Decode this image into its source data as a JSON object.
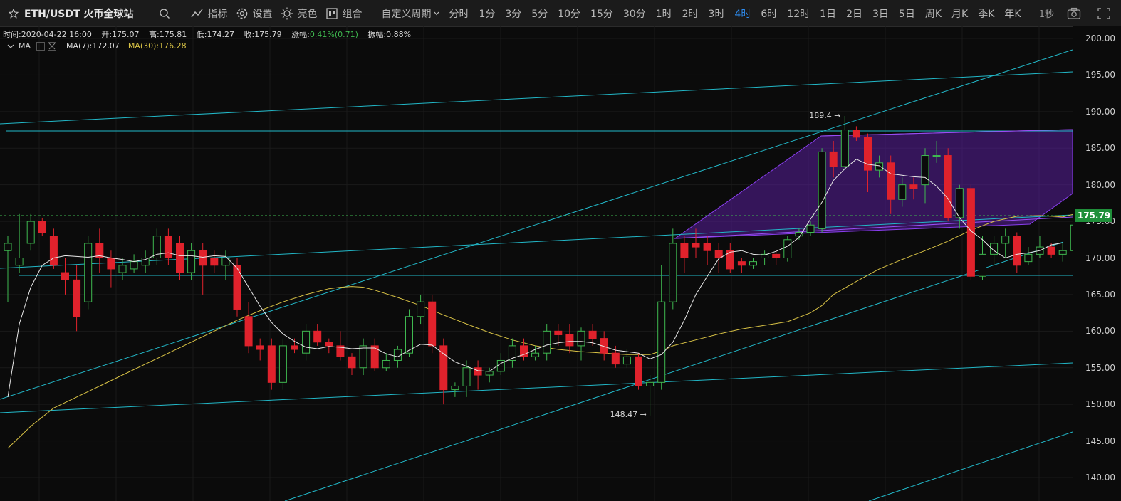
{
  "toolbar": {
    "title": "ETH/USDT 火币全球站",
    "buttons": {
      "indicators": "指标",
      "settings": "设置",
      "theme": "亮色",
      "combo": "组合"
    },
    "custom_period": "自定义周期",
    "periods": [
      "分时",
      "1分",
      "3分",
      "5分",
      "10分",
      "15分",
      "30分",
      "1时",
      "2时",
      "3时",
      "4时",
      "6时",
      "12时",
      "1日",
      "2日",
      "3日",
      "5日",
      "周K",
      "月K",
      "季K",
      "年K"
    ],
    "active_period": "4时",
    "refresh": "1秒"
  },
  "info": {
    "time": "时间:2020-04-22 16:00",
    "open": "开:175.07",
    "high": "高:175.81",
    "low": "低:174.27",
    "close": "收:175.79",
    "change_label": "涨幅:",
    "change_value": "0.41%(0.71)",
    "amplitude": "振幅:0.88%"
  },
  "ma": {
    "name": "MA",
    "ma7": "MA(7):172.07",
    "ma30": "MA(30):176.28"
  },
  "colors": {
    "up": "#3fb950",
    "down": "#e0222c",
    "ma7": "#e8e8e8",
    "ma30": "#d8c245",
    "trendline": "#22b8c8",
    "channel": "#7a2fd0",
    "current_price_bg": "#1f8f3a",
    "active_period": "#2d8cf0"
  },
  "chart_data": {
    "type": "candlestick",
    "y_ticks": [
      "200.00",
      "195.00",
      "190.00",
      "185.00",
      "180.00",
      "175.00",
      "170.00",
      "165.00",
      "160.00",
      "155.00",
      "150.00",
      "145.00",
      "140.00"
    ],
    "ylim": [
      137.5,
      202
    ],
    "current_price": "175.79",
    "annotations": {
      "high": "189.4 →",
      "low": "148.47 →"
    },
    "candles": [
      [
        171.0,
        172.0,
        164.0,
        173.0
      ],
      [
        169.0,
        170.0,
        168.0,
        176.0
      ],
      [
        172.0,
        175.0,
        171.0,
        176.0
      ],
      [
        175.0,
        173.5,
        173.0,
        175.5
      ],
      [
        173.0,
        169.0,
        168.5,
        174.0
      ],
      [
        168.0,
        167.0,
        165.0,
        170.0
      ],
      [
        167.0,
        162.0,
        160.0,
        169.0
      ],
      [
        164.0,
        172.0,
        163.0,
        173.0
      ],
      [
        172.0,
        170.0,
        168.0,
        174.0
      ],
      [
        170.0,
        168.5,
        166.0,
        171.0
      ],
      [
        168.0,
        169.0,
        167.0,
        170.0
      ],
      [
        168.5,
        169.5,
        168.0,
        170.5
      ],
      [
        169.0,
        170.0,
        168.0,
        171.0
      ],
      [
        170.0,
        173.0,
        169.0,
        174.0
      ],
      [
        173.0,
        170.0,
        169.0,
        174.0
      ],
      [
        172.0,
        168.0,
        167.0,
        173.0
      ],
      [
        168.0,
        171.0,
        167.0,
        172.0
      ],
      [
        171.0,
        169.0,
        165.0,
        172.0
      ],
      [
        170.0,
        169.0,
        168.0,
        171.0
      ],
      [
        169.0,
        170.0,
        167.0,
        171.0
      ],
      [
        169.0,
        163.0,
        162.0,
        170.0
      ],
      [
        162.0,
        158.0,
        157.0,
        164.0
      ],
      [
        158.0,
        157.5,
        156.0,
        159.0
      ],
      [
        158.0,
        153.0,
        152.0,
        159.0
      ],
      [
        153.0,
        158.0,
        152.0,
        159.0
      ],
      [
        158.0,
        157.5,
        157.0,
        159.0
      ],
      [
        157.0,
        160.0,
        156.0,
        161.0
      ],
      [
        160.0,
        158.5,
        158.0,
        161.0
      ],
      [
        158.5,
        158.0,
        157.0,
        159.0
      ],
      [
        158.0,
        156.5,
        156.0,
        160.0
      ],
      [
        156.5,
        155.0,
        154.0,
        157.0
      ],
      [
        155.0,
        158.0,
        154.0,
        159.0
      ],
      [
        158.0,
        155.0,
        154.5,
        159.0
      ],
      [
        155.0,
        156.0,
        154.5,
        157.0
      ],
      [
        156.0,
        157.5,
        155.0,
        158.0
      ],
      [
        157.0,
        162.0,
        156.5,
        163.0
      ],
      [
        162.0,
        164.0,
        161.0,
        165.0
      ],
      [
        164.0,
        158.0,
        157.0,
        165.0
      ],
      [
        158.0,
        152.0,
        150.0,
        159.0
      ],
      [
        152.0,
        152.5,
        151.0,
        153.0
      ],
      [
        152.5,
        155.0,
        151.0,
        156.0
      ],
      [
        155.0,
        154.0,
        152.0,
        156.0
      ],
      [
        154.0,
        154.5,
        153.0,
        155.0
      ],
      [
        154.5,
        156.0,
        154.0,
        157.0
      ],
      [
        156.0,
        158.0,
        155.0,
        159.0
      ],
      [
        158.0,
        156.5,
        156.0,
        159.0
      ],
      [
        156.5,
        157.0,
        156.0,
        158.0
      ],
      [
        157.0,
        160.0,
        156.0,
        161.0
      ],
      [
        160.0,
        159.5,
        158.0,
        161.0
      ],
      [
        159.5,
        158.0,
        157.0,
        161.0
      ],
      [
        158.0,
        160.0,
        156.0,
        160.5
      ],
      [
        160.0,
        159.0,
        158.0,
        161.0
      ],
      [
        159.0,
        157.0,
        156.0,
        160.0
      ],
      [
        157.0,
        155.5,
        155.0,
        158.0
      ],
      [
        155.5,
        156.5,
        155.0,
        157.5
      ],
      [
        156.5,
        152.5,
        152.0,
        157.0
      ],
      [
        152.5,
        153.0,
        148.47,
        154.0
      ],
      [
        153.0,
        164.0,
        152.0,
        169.0
      ],
      [
        164.0,
        172.0,
        163.0,
        174.0
      ],
      [
        172.0,
        170.0,
        168.0,
        173.0
      ],
      [
        172.0,
        171.5,
        170.0,
        174.0
      ],
      [
        172.0,
        171.0,
        169.0,
        173.0
      ],
      [
        171.0,
        170.0,
        168.0,
        172.0
      ],
      [
        171.0,
        168.5,
        168.0,
        172.0
      ],
      [
        169.5,
        169.0,
        168.0,
        170.0
      ],
      [
        169.0,
        169.5,
        168.5,
        170.0
      ],
      [
        170.0,
        170.5,
        169.0,
        171.0
      ],
      [
        170.5,
        170.0,
        169.0,
        171.0
      ],
      [
        170.0,
        172.5,
        169.5,
        173.0
      ],
      [
        173.0,
        173.5,
        172.5,
        174.0
      ],
      [
        173.5,
        174.5,
        173.0,
        175.0
      ],
      [
        174.0,
        184.5,
        173.5,
        185.0
      ],
      [
        184.5,
        182.5,
        181.0,
        186.0
      ],
      [
        182.5,
        187.5,
        182.0,
        189.4
      ],
      [
        187.5,
        186.5,
        186.0,
        188.0
      ],
      [
        186.5,
        182.0,
        179.0,
        187.0
      ],
      [
        182.0,
        183.0,
        181.0,
        184.0
      ],
      [
        183.0,
        178.0,
        176.0,
        184.0
      ],
      [
        178.0,
        180.0,
        177.0,
        181.0
      ],
      [
        180.0,
        179.5,
        178.0,
        181.0
      ],
      [
        180.0,
        184.0,
        177.5,
        185.0
      ],
      [
        184.0,
        184.0,
        183.0,
        186.0
      ],
      [
        184.0,
        175.5,
        175.0,
        185.0
      ],
      [
        175.5,
        179.5,
        174.0,
        180.0
      ],
      [
        179.5,
        167.5,
        167.0,
        180.0
      ],
      [
        167.5,
        170.5,
        167.0,
        173.0
      ],
      [
        170.5,
        172.0,
        169.0,
        173.0
      ],
      [
        172.0,
        173.0,
        170.0,
        174.0
      ],
      [
        173.0,
        169.0,
        168.0,
        173.5
      ],
      [
        169.5,
        170.5,
        169.0,
        171.5
      ],
      [
        170.5,
        171.5,
        170.0,
        173.0
      ],
      [
        171.5,
        170.5,
        170.0,
        172.0
      ],
      [
        170.5,
        171.0,
        169.5,
        172.0
      ],
      [
        171.0,
        174.5,
        170.0,
        175.5
      ],
      [
        175.07,
        175.79,
        174.27,
        175.81
      ]
    ],
    "ma7": [
      [
        0,
        151
      ],
      [
        1,
        161
      ],
      [
        2,
        166
      ],
      [
        3,
        169
      ],
      [
        4,
        170
      ],
      [
        5,
        170.3
      ],
      [
        6,
        170.2
      ],
      [
        7,
        170.1
      ],
      [
        8,
        170.3
      ],
      [
        9,
        170
      ],
      [
        10,
        169.8
      ],
      [
        11,
        169.5
      ],
      [
        12,
        169.8
      ],
      [
        13,
        170.5
      ],
      [
        14,
        170.7
      ],
      [
        15,
        170.3
      ],
      [
        16,
        170.3
      ],
      [
        17,
        170.1
      ],
      [
        18,
        170.3
      ],
      [
        19,
        170.2
      ],
      [
        20,
        168.6
      ],
      [
        21,
        166
      ],
      [
        22,
        163.4
      ],
      [
        23,
        161.2
      ],
      [
        24,
        159.6
      ],
      [
        25,
        158.6
      ],
      [
        26,
        157.8
      ],
      [
        27,
        157.6
      ],
      [
        28,
        157.9
      ],
      [
        29,
        157.8
      ],
      [
        30,
        157.6
      ],
      [
        31,
        157.7
      ],
      [
        32,
        157.7
      ],
      [
        33,
        156.9
      ],
      [
        34,
        156.5
      ],
      [
        35,
        157.4
      ],
      [
        36,
        158.2
      ],
      [
        37,
        158.1
      ],
      [
        38,
        156.9
      ],
      [
        39,
        155.8
      ],
      [
        40,
        155.2
      ],
      [
        41,
        154.6
      ],
      [
        42,
        154.5
      ],
      [
        43,
        155.6
      ],
      [
        44,
        156.3
      ],
      [
        45,
        156.8
      ],
      [
        46,
        157.5
      ],
      [
        47,
        158.1
      ],
      [
        48,
        158.4
      ],
      [
        49,
        158.6
      ],
      [
        50,
        158.6
      ],
      [
        51,
        158.4
      ],
      [
        52,
        157.9
      ],
      [
        53,
        157.4
      ],
      [
        54,
        157.2
      ],
      [
        55,
        157
      ],
      [
        56,
        156.2
      ],
      [
        57,
        156.8
      ],
      [
        58,
        158.5
      ],
      [
        59,
        161.5
      ],
      [
        60,
        165
      ],
      [
        61,
        167.5
      ],
      [
        62,
        169.9
      ],
      [
        63,
        170.8
      ],
      [
        64,
        171
      ],
      [
        65,
        170.5
      ],
      [
        66,
        170.4
      ],
      [
        67,
        170.9
      ],
      [
        68,
        171.6
      ],
      [
        69,
        172.8
      ],
      [
        70,
        175.3
      ],
      [
        71,
        177.6
      ],
      [
        72,
        180.6
      ],
      [
        73,
        182.2
      ],
      [
        74,
        183.5
      ],
      [
        75,
        182.8
      ],
      [
        76,
        182.6
      ],
      [
        77,
        181.5
      ],
      [
        78,
        181.3
      ],
      [
        79,
        181.1
      ],
      [
        80,
        181
      ],
      [
        81,
        179.8
      ],
      [
        82,
        178.1
      ],
      [
        83,
        175.5
      ],
      [
        84,
        173.7
      ],
      [
        85,
        172.5
      ],
      [
        86,
        171
      ],
      [
        87,
        170
      ],
      [
        88,
        170.5
      ],
      [
        89,
        170.7
      ],
      [
        90,
        171
      ],
      [
        91,
        171.8
      ],
      [
        92,
        172.07
      ]
    ],
    "ma30": [
      [
        0,
        144
      ],
      [
        2,
        147
      ],
      [
        4,
        149.5
      ],
      [
        6,
        151
      ],
      [
        8,
        152.5
      ],
      [
        10,
        154
      ],
      [
        12,
        155.5
      ],
      [
        14,
        157
      ],
      [
        16,
        158.5
      ],
      [
        18,
        160
      ],
      [
        20,
        161.5
      ],
      [
        22,
        162.8
      ],
      [
        24,
        164
      ],
      [
        26,
        165
      ],
      [
        28,
        165.8
      ],
      [
        29,
        166
      ],
      [
        30,
        166.1
      ],
      [
        31,
        166
      ],
      [
        32,
        165.6
      ],
      [
        34,
        164.6
      ],
      [
        36,
        163.5
      ],
      [
        38,
        162.2
      ],
      [
        40,
        161
      ],
      [
        42,
        159.8
      ],
      [
        44,
        158.8
      ],
      [
        46,
        158
      ],
      [
        48,
        157.5
      ],
      [
        50,
        157.2
      ],
      [
        52,
        157
      ],
      [
        54,
        156.8
      ],
      [
        56,
        156.8
      ],
      [
        57,
        157.3
      ],
      [
        58,
        158
      ],
      [
        60,
        158.8
      ],
      [
        62,
        159.6
      ],
      [
        64,
        160.3
      ],
      [
        66,
        160.8
      ],
      [
        68,
        161.3
      ],
      [
        70,
        162.5
      ],
      [
        71,
        163.5
      ],
      [
        72,
        165
      ],
      [
        74,
        166.8
      ],
      [
        76,
        168.5
      ],
      [
        78,
        169.8
      ],
      [
        80,
        171
      ],
      [
        82,
        172.3
      ],
      [
        84,
        173.8
      ],
      [
        86,
        175
      ],
      [
        88,
        175.7
      ],
      [
        90,
        175.8
      ],
      [
        92,
        175.6
      ],
      [
        93,
        176.0
      ]
    ]
  }
}
